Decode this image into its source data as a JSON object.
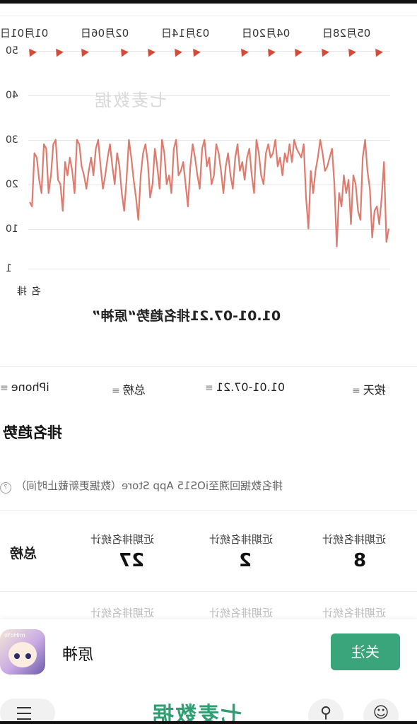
{
  "chart_data": {
    "type": "line",
    "title": "01.01-07.21排名趋势“原神”",
    "ylabel": "排名",
    "x_ticks": [
      "01月01日",
      "02月06日",
      "03月14日",
      "04月20日",
      "05月28日"
    ],
    "y_ticks": [
      "1",
      "10",
      "20",
      "30",
      "40",
      "50"
    ],
    "ylim": [
      1,
      50
    ],
    "y_inverted": true,
    "grid": true,
    "series": [
      {
        "color": "#e07a6d",
        "values": [
          16,
          15,
          27,
          26,
          21,
          18,
          29,
          28,
          18,
          22,
          29,
          30,
          21,
          20,
          14,
          25,
          22,
          26,
          23,
          18,
          30,
          29,
          24,
          22,
          19,
          23,
          26,
          22,
          28,
          30,
          24,
          19,
          22,
          26,
          29,
          24,
          20,
          27,
          24,
          18,
          14,
          21,
          30,
          26,
          21,
          17,
          12,
          22,
          27,
          29,
          25,
          17,
          20,
          28,
          24,
          19,
          30,
          27,
          20,
          22,
          18,
          28,
          30,
          22,
          23,
          25,
          20,
          15,
          24,
          29,
          26,
          22,
          19,
          28,
          30,
          24,
          26,
          20,
          22,
          29,
          27,
          23,
          18,
          24,
          27,
          22,
          19,
          26,
          29,
          23,
          25,
          21,
          26,
          28,
          22,
          18,
          30,
          27,
          22,
          20,
          27,
          29,
          26,
          27,
          30,
          24,
          26,
          22,
          27,
          25,
          29,
          25,
          30,
          28,
          27,
          26,
          29,
          17,
          10,
          23,
          18,
          23,
          26,
          30,
          27,
          23,
          24,
          26,
          28,
          20,
          6,
          18,
          15,
          22,
          18,
          21,
          11,
          22,
          20,
          14,
          12,
          26,
          30,
          23,
          19,
          8,
          14,
          15,
          11,
          17,
          25,
          7,
          10
        ]
      }
    ]
  },
  "watermark": "七麦数据",
  "filters": {
    "iphone": "iPhone",
    "region": "总榜",
    "date_range": "01.01-07.21",
    "period": "按天",
    "caret": "≡"
  },
  "section_title": "排名趋势",
  "note": "排名数据回溯至iOS15 App Store（数据更新截止时间）",
  "note_icon": "?",
  "stats": {
    "row_label": "总榜",
    "items": [
      {
        "label": "近期排名统计",
        "value": "27"
      },
      {
        "label": "近期排名统计",
        "value": "2"
      },
      {
        "label": "近期排名统计",
        "value": "8"
      }
    ]
  },
  "app": {
    "name": "原神",
    "follow_label": "关注",
    "icon_tiny_text": "miHoYo"
  },
  "brand": "七麦数据",
  "nav_icons": {
    "menu": "menu-icon",
    "search": "search-icon",
    "mine": "user-icon"
  }
}
